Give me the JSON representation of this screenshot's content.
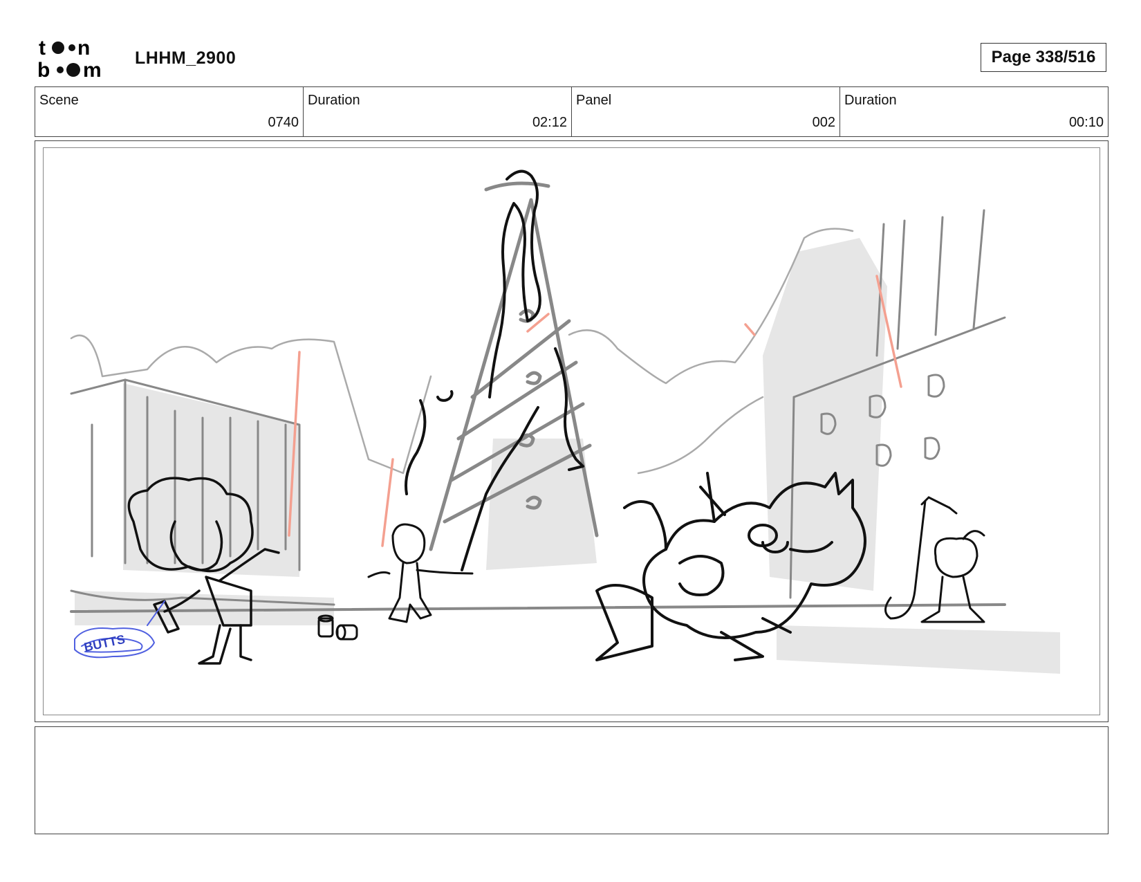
{
  "header": {
    "logo_text": "toon boom",
    "project_title": "LHHM_2900",
    "page_label": "Page 338/516"
  },
  "info": {
    "scene_label": "Scene",
    "scene_value": "0740",
    "scene_duration_label": "Duration",
    "scene_duration_value": "02:12",
    "panel_label": "Panel",
    "panel_value": "002",
    "panel_duration_label": "Duration",
    "panel_duration_value": "00:10"
  },
  "panel": {
    "graffiti_text": "BUTTS"
  },
  "notes": {
    "text": ""
  }
}
